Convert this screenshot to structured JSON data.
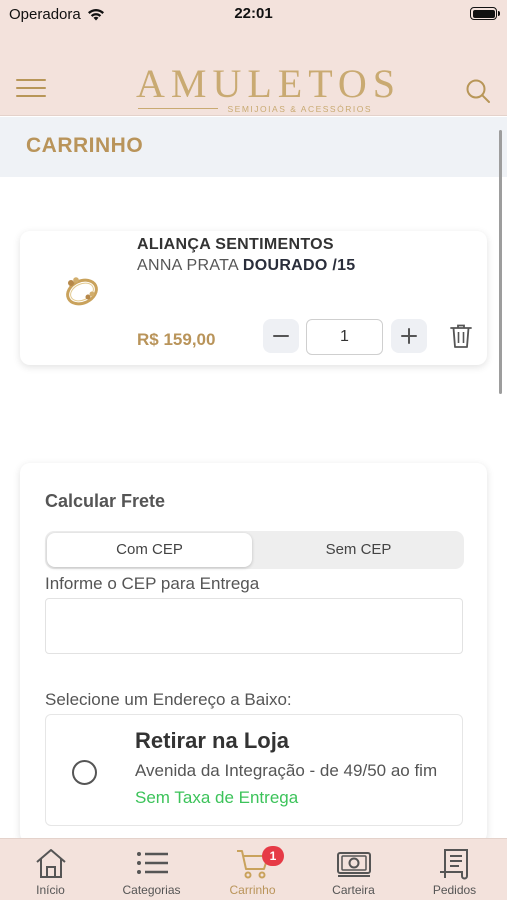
{
  "status_bar": {
    "carrier": "Operadora",
    "time": "22:01"
  },
  "header": {
    "logo_title": "AMULETOS",
    "logo_subtitle": "SEMIJOIAS & ACESSÓRIOS",
    "menu_icon": "hamburger-menu-icon",
    "search_icon": "search-icon"
  },
  "page": {
    "title": "CARRINHO"
  },
  "cart": {
    "items": [
      {
        "name": "ALIANÇA SENTIMENTOS",
        "variant_prefix": "ANNA PRATA",
        "variant_bold": "DOURADO /15",
        "price": "R$ 159,00",
        "quantity": "1"
      }
    ]
  },
  "shipping": {
    "title": "Calcular Frete",
    "segments": [
      "Com CEP",
      "Sem CEP"
    ],
    "selected_segment": "Com CEP",
    "cep_label": "Informe o CEP para Entrega",
    "cep_value": "",
    "address_label": "Selecione um Endereço a Baixo:",
    "addresses": [
      {
        "title": "Retirar na Loja",
        "street": "Avenida da Integração - de 49/50 ao fim",
        "fee": "Sem Taxa de Entrega"
      }
    ]
  },
  "tab_bar": {
    "tabs": [
      {
        "label": "Início",
        "icon": "home-icon"
      },
      {
        "label": "Categorias",
        "icon": "list-icon"
      },
      {
        "label": "Carrinho",
        "icon": "cart-icon",
        "badge": "1",
        "active": true
      },
      {
        "label": "Carteira",
        "icon": "wallet-icon"
      },
      {
        "label": "Pedidos",
        "icon": "orders-icon"
      }
    ]
  },
  "colors": {
    "header_bg": "#f3e2dc",
    "accent_gold": "#b9945a",
    "success_green": "#3cc35a",
    "badge_red": "#e63a46"
  }
}
